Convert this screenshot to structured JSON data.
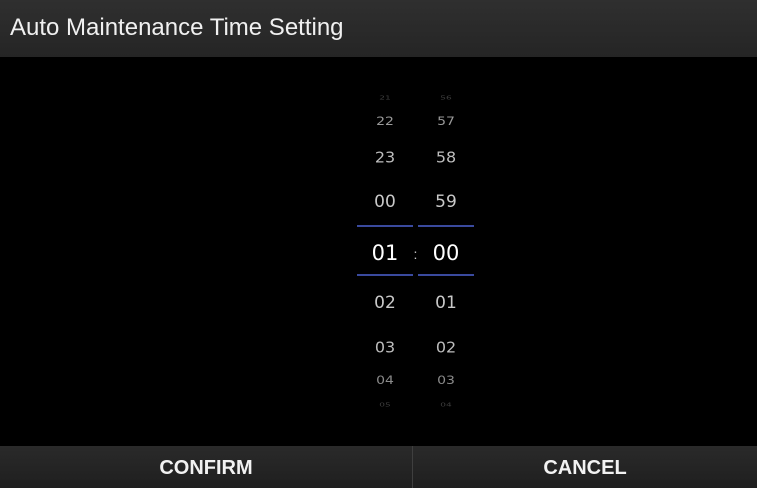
{
  "dialog": {
    "title": "Auto Maintenance Time Setting"
  },
  "time_picker": {
    "separator": ":",
    "hours": [
      "21",
      "22",
      "23",
      "00",
      "01",
      "02",
      "03",
      "04",
      "05"
    ],
    "minutes": [
      "56",
      "57",
      "58",
      "59",
      "00",
      "01",
      "02",
      "03",
      "04"
    ],
    "selected_hour": "01",
    "selected_minute": "00",
    "divider_color": "#3a4a9e"
  },
  "buttons": {
    "confirm_label": "CONFIRM",
    "cancel_label": "CANCEL"
  }
}
